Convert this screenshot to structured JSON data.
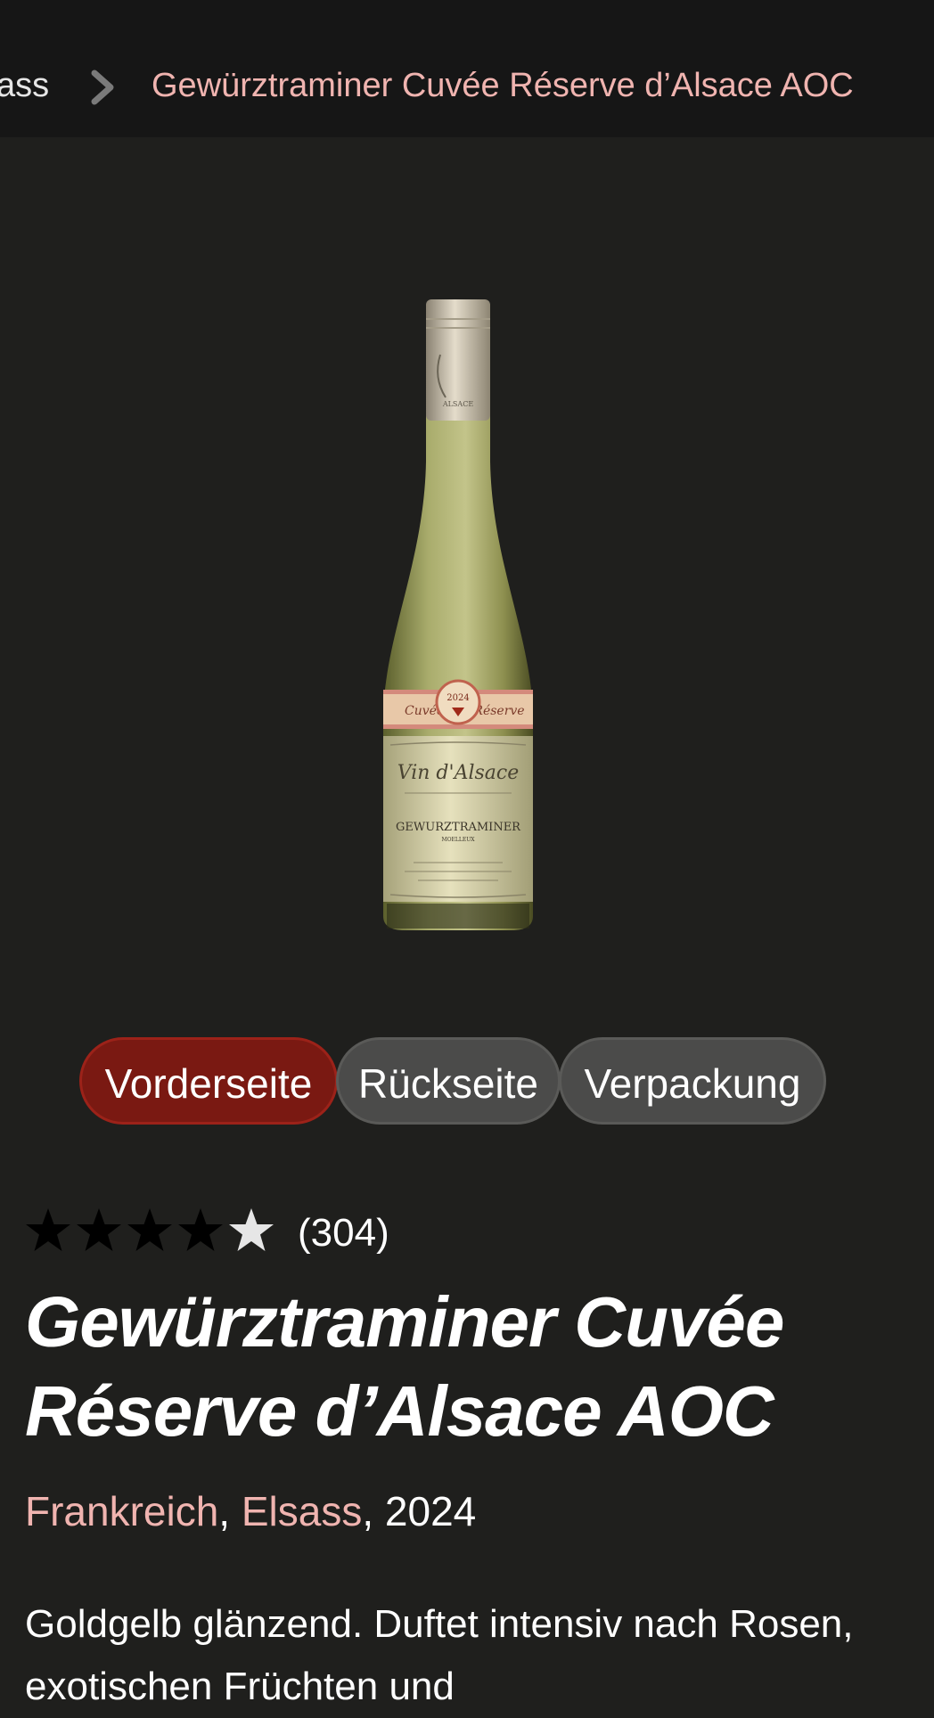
{
  "breadcrumb": {
    "previous": "ass",
    "current": "Gewürztraminer Cuvée Réserve d’Alsace AOC"
  },
  "product_image": {
    "label_top": "ALSACE",
    "label_cuvee": "Cuvée",
    "label_reserve": "Réserve",
    "label_year": "2024",
    "label_vin": "Vin d'Alsace",
    "label_variety": "GEWURZTRAMINER",
    "label_style": "MOELLEUX"
  },
  "view_tabs": [
    {
      "label": "Vorderseite",
      "active": true
    },
    {
      "label": "Rückseite",
      "active": false
    },
    {
      "label": "Verpackung",
      "active": false
    }
  ],
  "rating": {
    "stars_filled": 4,
    "stars_total": 5,
    "count": "(304)"
  },
  "product": {
    "title": "Gewürztraminer Cuvée Réserve d’Alsace AOC",
    "country": "Frankreich",
    "sep1": ", ",
    "region": "Elsass",
    "sep2": ", ",
    "vintage": "2024",
    "description": "Goldgelb glänzend. Duftet intensiv nach Rosen, exotischen Früchten und"
  },
  "colors": {
    "background": "#1f1f1d",
    "topbar": "#161616",
    "accent_pink": "#f0b4b0",
    "active_tab": "#7a1912",
    "inactive_tab": "#4b4b4a"
  }
}
